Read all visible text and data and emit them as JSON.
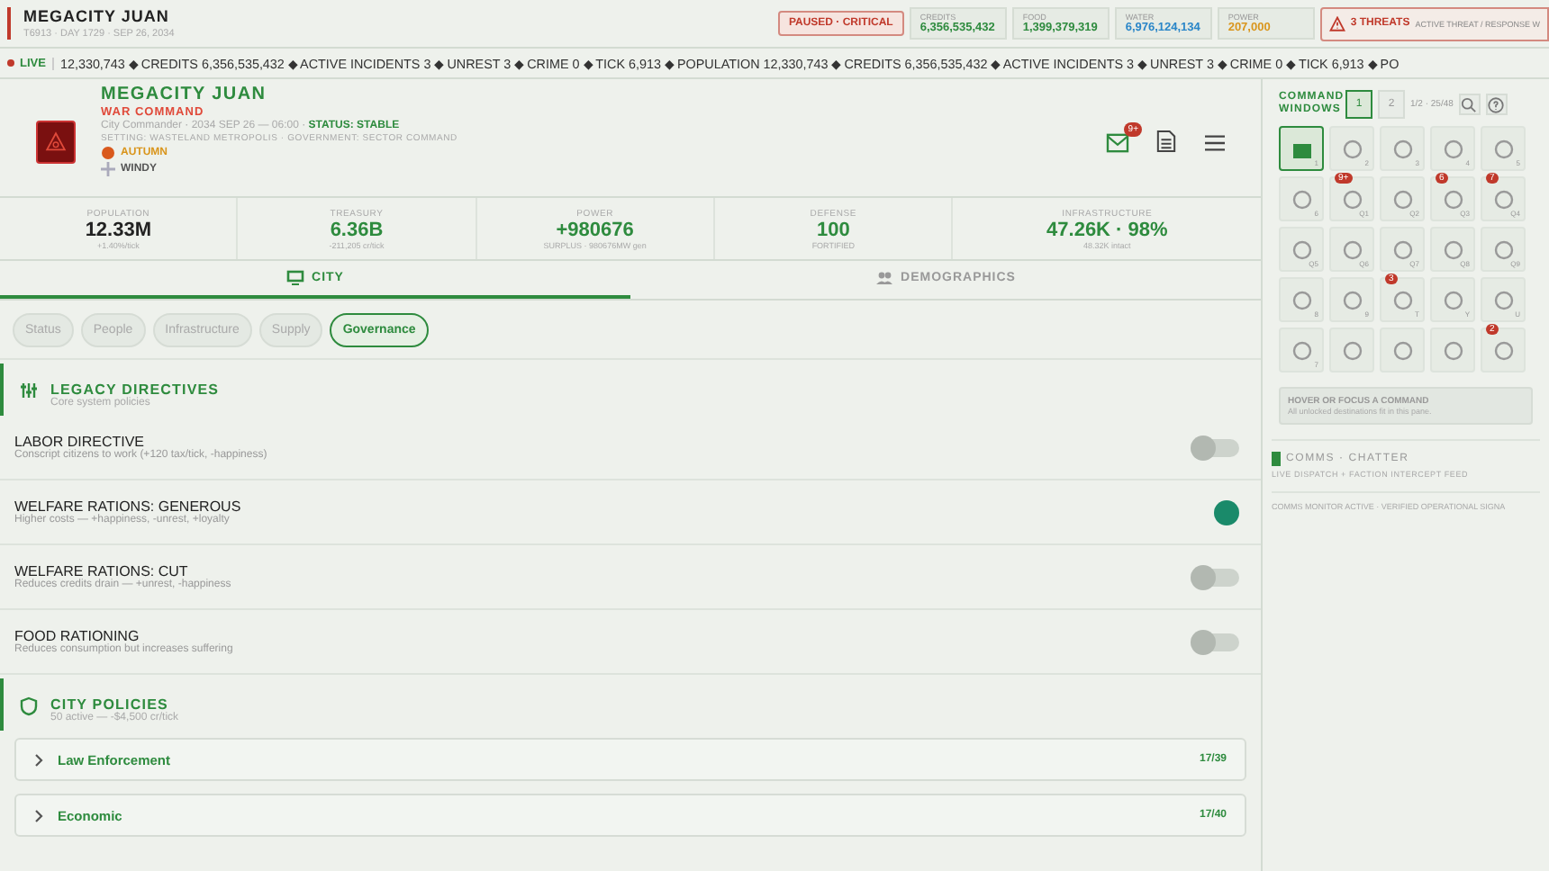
{
  "topbar": {
    "title": "MEGACITY JUAN",
    "subtitle": "T6913 · DAY 1729 · SEP 26, 2034",
    "status": "PAUSED · CRITICAL",
    "resources": [
      {
        "label": "CREDITS",
        "value": "6,356,535,432",
        "color": "#2e8b3e"
      },
      {
        "label": "FOOD",
        "value": "1,399,379,319",
        "color": "#2e8b3e"
      },
      {
        "label": "WATER",
        "value": "6,976,124,134",
        "color": "#2a86c8"
      },
      {
        "label": "POWER",
        "value": "207,000",
        "color": "#d9951c"
      }
    ],
    "threats": {
      "label": "3 THREATS",
      "detail": "ACTIVE THREAT / RESPONSE W"
    }
  },
  "ticker": {
    "live": "LIVE",
    "text": "12,330,743 ◆ CREDITS 6,356,535,432 ◆ ACTIVE INCIDENTS 3 ◆ UNREST 3 ◆ CRIME 0 ◆ TICK 6,913 ◆ POPULATION 12,330,743 ◆ CREDITS 6,356,535,432 ◆ ACTIVE INCIDENTS 3 ◆ UNREST 3 ◆ CRIME 0 ◆ TICK 6,913 ◆ PO"
  },
  "header": {
    "name": "MEGACITY JUAN",
    "role": "WAR COMMAND",
    "line": "City Commander · 2034 SEP 26 — 06:00 · ",
    "status": "STATUS: STABLE",
    "setting": "SETTING: WASTELAND METROPOLIS · GOVERNMENT: SECTOR COMMAND",
    "season": "AUTUMN",
    "weather": "WINDY",
    "mail_badge": "9+"
  },
  "stats": [
    {
      "label": "POPULATION",
      "value": "12.33M",
      "sub": "+1.40%/tick",
      "color": "#222222"
    },
    {
      "label": "TREASURY",
      "value": "6.36B",
      "sub": "-211,205 cr/tick",
      "color": "#2e8b3e"
    },
    {
      "label": "POWER",
      "value": "+980676",
      "sub": "SURPLUS · 980676MW gen",
      "color": "#2e8b3e"
    },
    {
      "label": "DEFENSE",
      "value": "100",
      "sub": "FORTIFIED",
      "color": "#2e8b3e"
    },
    {
      "label": "INFRASTRUCTURE",
      "value": "47.26K · 98%",
      "sub": "48.32K intact",
      "color": "#2e8b3e"
    }
  ],
  "tabs": [
    {
      "label": "CITY",
      "selected": true
    },
    {
      "label": "DEMOGRAPHICS",
      "selected": false
    }
  ],
  "subtabs": [
    {
      "label": "Status",
      "selected": false
    },
    {
      "label": "People",
      "selected": false
    },
    {
      "label": "Infrastructure",
      "selected": false
    },
    {
      "label": "Supply",
      "selected": false
    },
    {
      "label": "Governance",
      "selected": true
    }
  ],
  "directives": {
    "title": "LEGACY DIRECTIVES",
    "subtitle": "Core system policies",
    "items": [
      {
        "name": "LABOR DIRECTIVE",
        "desc": "Conscript citizens to work (+120 tax/tick, -happiness)",
        "on": false
      },
      {
        "name": "WELFARE RATIONS: GENEROUS",
        "desc": "Higher costs — +happiness, -unrest, +loyalty",
        "on": true
      },
      {
        "name": "WELFARE RATIONS: CUT",
        "desc": "Reduces credits drain — +unrest, -happiness",
        "on": false
      },
      {
        "name": "FOOD RATIONING",
        "desc": "Reduces consumption but increases suffering",
        "on": false
      }
    ]
  },
  "policies": {
    "title": "CITY POLICIES",
    "subtitle": "50 active — -$4,500 cr/tick",
    "items": [
      {
        "name": "Law Enforcement",
        "count": "17/39",
        "expanded": false
      },
      {
        "name": "Economic",
        "count": "17/40",
        "expanded": false
      }
    ]
  },
  "command": {
    "title": "COMMAND WINDOWS",
    "pages": [
      {
        "label": "1",
        "selected": true
      },
      {
        "label": "2",
        "selected": false
      }
    ],
    "range": "1/2 · 25/48",
    "cells": [
      {
        "key": "1",
        "selected": true
      },
      {
        "key": "2",
        "selected": false
      },
      {
        "key": "3",
        "selected": false
      },
      {
        "key": "4",
        "selected": false
      },
      {
        "key": "5",
        "selected": false
      },
      {
        "key": "6",
        "selected": false
      },
      {
        "key": "Q1",
        "badge": "9+",
        "selected": false
      },
      {
        "key": "Q2",
        "selected": false
      },
      {
        "key": "Q3",
        "badge": "6",
        "selected": false
      },
      {
        "key": "Q4",
        "badge": "7",
        "selected": false
      },
      {
        "key": "Q5",
        "selected": false
      },
      {
        "key": "Q6",
        "selected": false
      },
      {
        "key": "Q7",
        "selected": false
      },
      {
        "key": "Q8",
        "selected": false
      },
      {
        "key": "Q9",
        "selected": false
      },
      {
        "key": "8",
        "selected": false
      },
      {
        "key": "9",
        "selected": false
      },
      {
        "key": "T",
        "badge": "3",
        "selected": false
      },
      {
        "key": "Y",
        "selected": false
      },
      {
        "key": "U",
        "selected": false
      },
      {
        "key": "7",
        "selected": false
      },
      {
        "selected": false
      },
      {
        "selected": false
      },
      {
        "selected": false
      },
      {
        "badge": "2",
        "selected": false
      }
    ],
    "hint_title": "HOVER OR FOCUS A COMMAND",
    "hint_text": "All unlocked destinations fit in this pane."
  },
  "comms": {
    "title": "COMMS · CHATTER",
    "subtitle": "LIVE DISPATCH + FACTION INTERCEPT FEED",
    "line": "COMMS MONITOR ACTIVE · VERIFIED OPERATIONAL SIGNA"
  }
}
